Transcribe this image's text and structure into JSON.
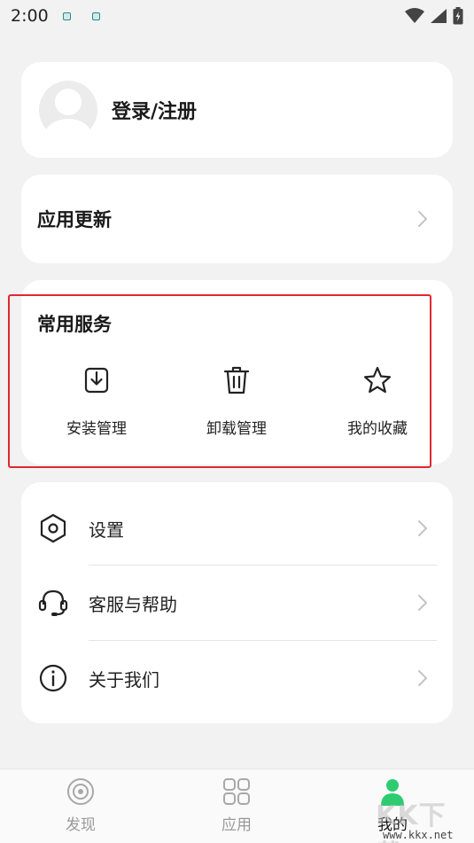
{
  "status_bar": {
    "time": "2:00"
  },
  "login": {
    "label": "登录/注册"
  },
  "update": {
    "title": "应用更新"
  },
  "services": {
    "title": "常用服务",
    "items": [
      {
        "label": "安装管理",
        "icon": "download-box-icon"
      },
      {
        "label": "卸载管理",
        "icon": "trash-icon"
      },
      {
        "label": "我的收藏",
        "icon": "star-icon"
      }
    ]
  },
  "menu": [
    {
      "label": "设置",
      "icon": "hexagon-gear-icon"
    },
    {
      "label": "客服与帮助",
      "icon": "headset-icon"
    },
    {
      "label": "关于我们",
      "icon": "info-icon"
    }
  ],
  "bottom_nav": [
    {
      "label": "发现",
      "icon": "discover-icon"
    },
    {
      "label": "应用",
      "icon": "apps-grid-icon"
    },
    {
      "label": "我的",
      "icon": "profile-icon",
      "active": true
    }
  ],
  "watermark": {
    "big": "KK下载",
    "small": "www.kkx.net"
  },
  "colors": {
    "accent_green": "#2ecc71",
    "highlight_red": "#e0282e"
  }
}
